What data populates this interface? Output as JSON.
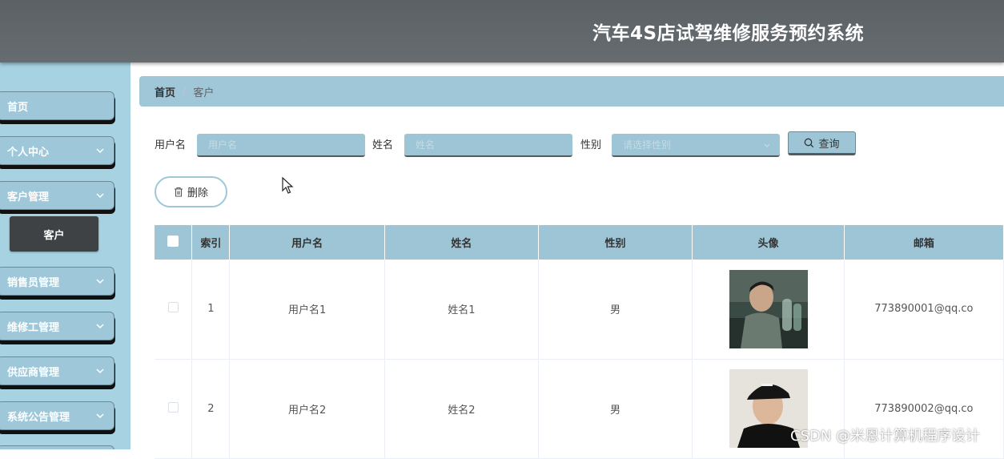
{
  "header": {
    "title": "汽车4S店试驾维修服务预约系统"
  },
  "sidebar": {
    "items": [
      {
        "label": "首页"
      },
      {
        "label": "个人中心"
      },
      {
        "label": "客户管理"
      },
      {
        "label": "销售员管理"
      },
      {
        "label": "维修工管理"
      },
      {
        "label": "供应商管理"
      },
      {
        "label": "系统公告管理"
      }
    ],
    "submenu": {
      "label": "客户"
    }
  },
  "breadcrumb": {
    "home": "首页",
    "separator": "/",
    "current": "客户"
  },
  "search": {
    "username_label": "用户名",
    "username_placeholder": "用户名",
    "name_label": "姓名",
    "name_placeholder": "姓名",
    "gender_label": "性别",
    "gender_placeholder": "请选择性别",
    "query_label": "查询"
  },
  "actions": {
    "delete_label": "删除"
  },
  "table": {
    "columns": [
      "索引",
      "用户名",
      "姓名",
      "性别",
      "头像",
      "邮箱"
    ],
    "rows": [
      {
        "index": "1",
        "username": "用户名1",
        "name": "姓名1",
        "gender": "男",
        "email": "773890001@qq.co"
      },
      {
        "index": "2",
        "username": "用户名2",
        "name": "姓名2",
        "gender": "男",
        "email": "773890002@qq.co"
      }
    ]
  },
  "watermark": "CSDN @米恩计算机程序设计",
  "colors": {
    "accent": "#9ec5d6",
    "sidebar_bg": "#a6d2e2",
    "header_bg": "#5f666a",
    "submenu_active": "#3e4245"
  }
}
